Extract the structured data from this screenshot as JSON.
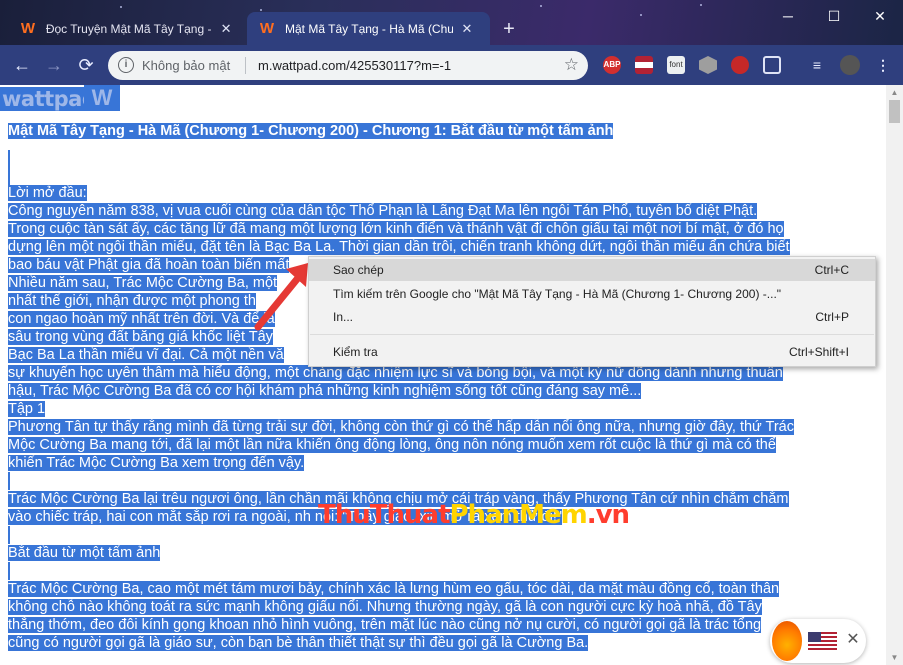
{
  "browser": {
    "tabs": [
      {
        "title": "Đọc Truyện Mật Mã Tây Tạng - Hà",
        "active": false
      },
      {
        "title": "Mật Mã Tây Tạng - Hà Mã (Chươ",
        "active": true
      }
    ],
    "newtab_label": "+",
    "window_buttons": {
      "minimize": "─",
      "maximize": "☐",
      "close": "✕"
    },
    "omnibox": {
      "security_label": "Không bảo mật",
      "url": "m.wattpad.com/425530117?m=-1"
    },
    "extensions": {
      "abp": "ABP",
      "font": "font"
    }
  },
  "page": {
    "logo_text": "wattpad",
    "logo_mark": "W",
    "chapter_title": "Mật Mã Tây Tạng - Hà Mã (Chương 1- Chương 200) - Chương 1: Bắt đầu từ một tấm ảnh",
    "paragraph1": [
      "Lời mở đầu:",
      "Công nguyên năm 838, vị vua cuối cùng của dân tộc Thổ Phạn là Lãng Đạt Ma lên ngôi Tán Phổ, tuyên bố diệt Phật.",
      "Trong cuộc tàn sát ấy, các tăng lữ đã mang một lượng lớn kinh điển và thánh vật đi chôn giấu tại một nơi bí mật, ở đó họ",
      "dựng lên một ngôi thần miếu, đặt tên là Bạc Ba La. Thời gian dần trôi, chiến tranh không dứt, ngôi thần miếu ẩn chứa biết",
      "bao báu vật Phật gia đã hoàn toàn biến mất",
      "Nhiều năm sau, Trác Mộc Cường Ba, một",
      "nhất thế giới, nhận được một phong th",
      "con ngao hoàn mỹ nhất trên đời. Và để là",
      "sâu trong vùng đất băng giá khốc liệt Tây",
      "Bạc Ba La thần miếu vĩ đại. Cả một nền vă",
      "sự khuyến học uyên thâm mà hiểu động, một chàng đặc nhiệm lực sĩ và bóng bội, và một kỳ nữ dõng dành nhưng thuần",
      "hậu, Trác Mộc Cường Ba đã có cơ hội khám phá những kinh nghiệm sống tốt cũng đáng say mê..."
    ],
    "tap_label": "Tập 1",
    "paragraph2": [
      "Phương Tân tự thấy rằng mình đã từng trải sự đời, không còn thứ gì có thể hấp dẫn nổi ông nữa, nhưng giờ đây, thứ Trác",
      "Mộc Cường Ba mang tới, đã lại một lần nữa khiến ông động lòng, ông nôn nóng muốn xem rốt cuộc là thứ gì mà có thể",
      "khiến Trác Mộc Cường Ba xem trọng đến vậy."
    ],
    "paragraph3": [
      "Trác Mộc Cường Ba lại trêu ngươi ông, lần chần mãi không chịu mở cái tráp vàng, thấy Phương Tân cứ nhìn chằm chằm",
      "vào chiếc tráp, hai con mắt sắp rơi ra ngoài,                                                     nh nói: \"Thầy giáo, xin mở ra xem thử đi!\""
    ],
    "section_heading": "Bắt đầu từ một tấm ảnh",
    "paragraph4": [
      "Trác Mộc Cường Ba, cao một mét tám mươi bảy, chính xác là lưng hùm eo gấu, tóc dài, da mặt màu đồng cổ, toàn thân",
      "không chỗ nào không toát ra sức mạnh không giấu nổi. Nhưng thường ngày, gã là con người cực kỳ hoà nhã, đồ Tây",
      "thẳng thớm, đeo đôi kính gọng khoan nhỏ hình vuông, trên mặt lúc nào cũng nở nụ cười, có người gọi gã là trác tổng",
      "cũng có người gọi gã là giáo sư, còn bạn bè thân thiết thật sự thì đều gọi gã là Cường Ba."
    ]
  },
  "context_menu": {
    "items": [
      {
        "label": "Sao chép",
        "shortcut": "Ctrl+C"
      },
      {
        "label": "Tìm kiếm trên Google cho \"Mật Mã Tây Tạng - Hà Mã (Chương 1- Chương 200) -...\"",
        "shortcut": ""
      },
      {
        "label": "In...",
        "shortcut": "Ctrl+P"
      },
      {
        "label": "Kiểm tra",
        "shortcut": "Ctrl+Shift+I"
      }
    ]
  },
  "watermark": {
    "part1": "Thu",
    "part2": "Thuat",
    "part3": "PhanMem",
    "part4": ".vn"
  },
  "widget": {
    "close_label": "✕"
  },
  "colors": {
    "selection": "#3875d7",
    "toolbar": "#2f3f7e",
    "watermark_red": "#ff3d2e",
    "watermark_yellow": "#ffd400"
  }
}
